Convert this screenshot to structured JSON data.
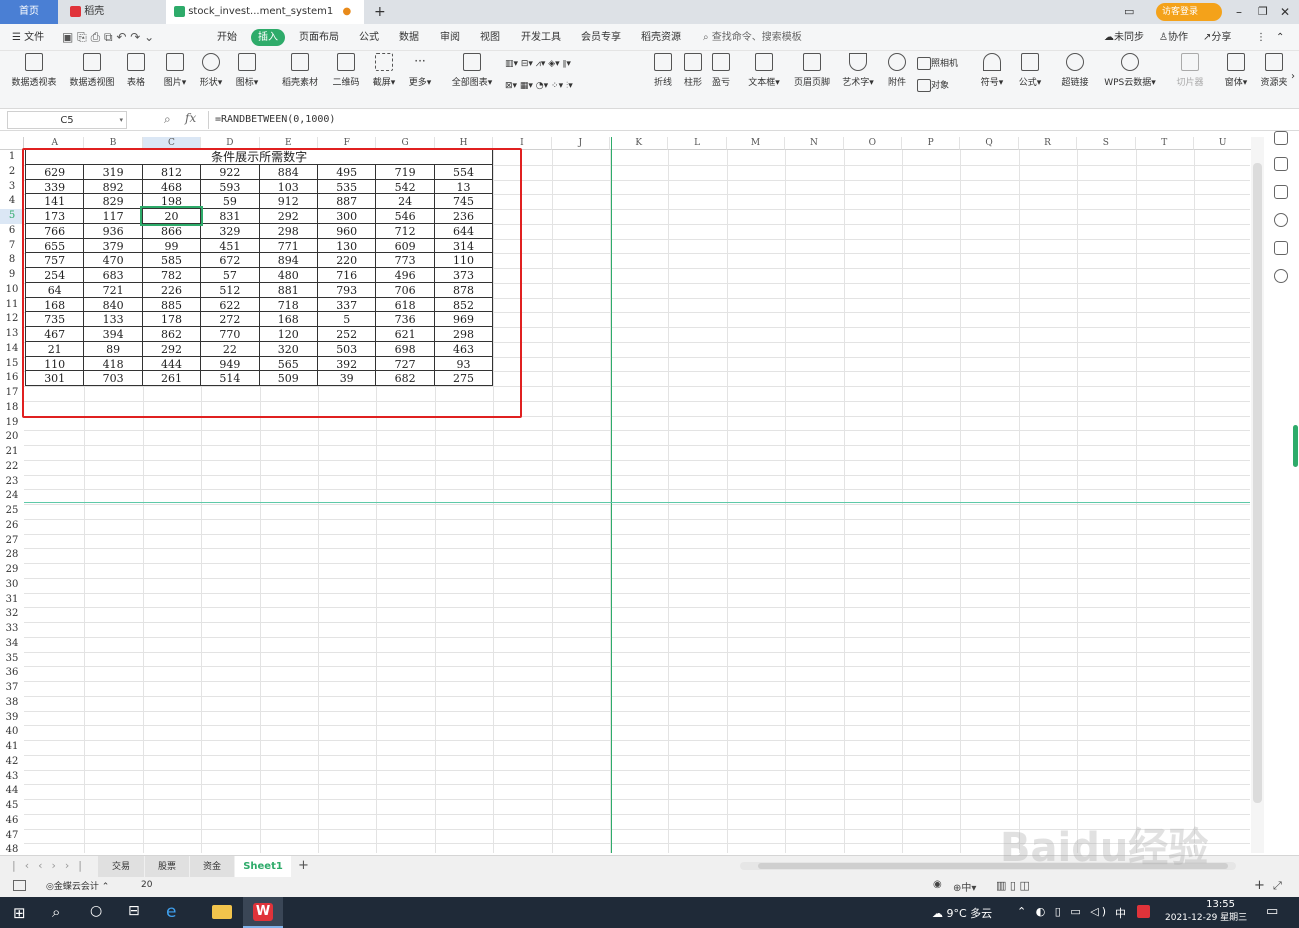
{
  "tabs": {
    "home": "首页",
    "docer": "稻壳",
    "file": "stock_invest...ment_system1",
    "new_tab": "+",
    "login": "访客登录"
  },
  "menu": {
    "file": "文件",
    "items": [
      "开始",
      "插入",
      "页面布局",
      "公式",
      "数据",
      "审阅",
      "视图",
      "开发工具",
      "会员专享",
      "稻壳资源"
    ],
    "active": "插入",
    "search": "查找命令、搜索模板",
    "sync": "未同步",
    "collab": "协作",
    "share": "分享"
  },
  "ribbon": {
    "big": [
      "数据透视表",
      "数据透视图",
      "表格",
      "图片",
      "形状",
      "图标",
      "稻壳素材",
      "二维码",
      "截屏",
      "更多",
      "全部图表",
      "折线",
      "柱形",
      "盈亏",
      "文本框",
      "页眉页脚",
      "艺术字",
      "附件",
      "符号",
      "公式",
      "超链接",
      "WPS云数据",
      "切片器",
      "窗体",
      "资源夹"
    ],
    "small": [
      "照相机",
      "对象"
    ]
  },
  "formula_bar": {
    "name_box": "C5",
    "fx": "fx",
    "formula": "=RANDBETWEEN(0,1000)"
  },
  "columns": [
    "A",
    "B",
    "C",
    "D",
    "E",
    "F",
    "G",
    "H",
    "I",
    "J",
    "K",
    "L",
    "M",
    "N",
    "O",
    "P",
    "Q",
    "R",
    "S",
    "T",
    "U"
  ],
  "row_count": 48,
  "table": {
    "title": "条件展示所需数字",
    "rows": [
      [
        629,
        319,
        812,
        922,
        884,
        495,
        719,
        554
      ],
      [
        339,
        892,
        468,
        593,
        103,
        535,
        542,
        13
      ],
      [
        141,
        829,
        198,
        59,
        912,
        887,
        24,
        745
      ],
      [
        173,
        117,
        20,
        831,
        292,
        300,
        546,
        236
      ],
      [
        766,
        936,
        866,
        329,
        298,
        960,
        712,
        644
      ],
      [
        655,
        379,
        99,
        451,
        771,
        130,
        609,
        314
      ],
      [
        757,
        470,
        585,
        672,
        894,
        220,
        773,
        110
      ],
      [
        254,
        683,
        782,
        57,
        480,
        716,
        496,
        373
      ],
      [
        64,
        721,
        226,
        512,
        881,
        793,
        706,
        878
      ],
      [
        168,
        840,
        885,
        622,
        718,
        337,
        618,
        852
      ],
      [
        735,
        133,
        178,
        272,
        168,
        5,
        736,
        969
      ],
      [
        467,
        394,
        862,
        770,
        120,
        252,
        621,
        298
      ],
      [
        21,
        89,
        292,
        22,
        320,
        503,
        698,
        463
      ],
      [
        110,
        418,
        444,
        949,
        565,
        392,
        727,
        93
      ],
      [
        301,
        703,
        261,
        514,
        509,
        39,
        682,
        275
      ]
    ],
    "selected_cell": "C5"
  },
  "sheets": {
    "items": [
      "交易",
      "股票",
      "资金",
      "Sheet1"
    ],
    "active": "Sheet1"
  },
  "status": {
    "plugin": "金蝶云会计",
    "value": "20",
    "zoom_label": "中"
  },
  "taskbar": {
    "weather": "9°C 多云",
    "ime": "中",
    "time": "13:55",
    "date": "2021-12-29 星期三"
  },
  "watermark": "Baidu经验",
  "colors": {
    "accent": "#2eab6a",
    "highlight_box": "#e02020",
    "taskbar": "#1f2a38",
    "login": "#f4a21a"
  }
}
